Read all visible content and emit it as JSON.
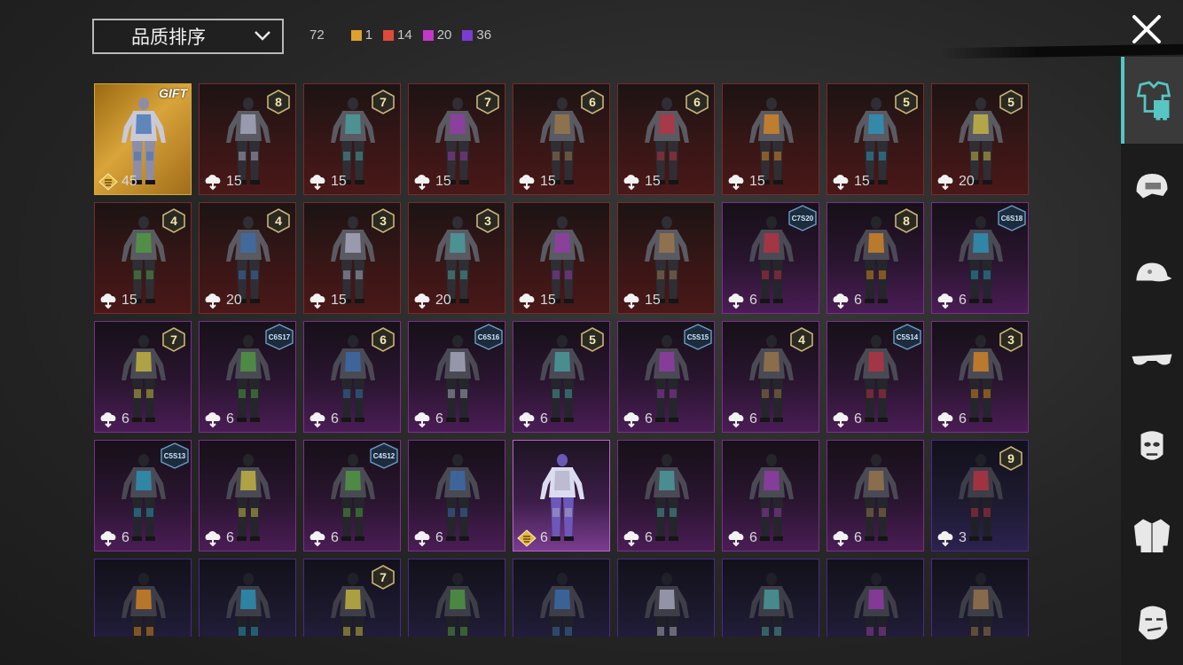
{
  "header": {
    "sort_label": "品质排序",
    "total": "72",
    "counts": [
      {
        "color": "#e0a12c",
        "value": "1"
      },
      {
        "color": "#e04a3a",
        "value": "14"
      },
      {
        "color": "#c338c8",
        "value": "20"
      },
      {
        "color": "#7b3bd4",
        "value": "36"
      }
    ]
  },
  "items": [
    {
      "rarity": "gold",
      "value": "45",
      "gift": "GIFT"
    },
    {
      "rarity": "legendary",
      "value": "15",
      "badge": "8"
    },
    {
      "rarity": "legendary",
      "value": "15",
      "badge": "7"
    },
    {
      "rarity": "legendary",
      "value": "15",
      "badge": "7"
    },
    {
      "rarity": "legendary",
      "value": "15",
      "badge": "6"
    },
    {
      "rarity": "legendary",
      "value": "15",
      "badge": "6"
    },
    {
      "rarity": "legendary",
      "value": "15"
    },
    {
      "rarity": "legendary",
      "value": "15",
      "badge": "5"
    },
    {
      "rarity": "legendary",
      "value": "20",
      "badge": "5"
    },
    {
      "rarity": "legendary",
      "value": "15",
      "badge": "4"
    },
    {
      "rarity": "legendary",
      "value": "20",
      "badge": "4"
    },
    {
      "rarity": "legendary",
      "value": "15",
      "badge": "3"
    },
    {
      "rarity": "legendary",
      "value": "20",
      "badge": "3"
    },
    {
      "rarity": "legendary",
      "value": "15"
    },
    {
      "rarity": "legendary",
      "value": "15"
    },
    {
      "rarity": "epic",
      "value": "6",
      "season": "C7S20"
    },
    {
      "rarity": "epic",
      "value": "6",
      "badge": "8"
    },
    {
      "rarity": "epic",
      "value": "6",
      "season": "C6S18"
    },
    {
      "rarity": "epic",
      "value": "6",
      "badge": "7"
    },
    {
      "rarity": "epic",
      "value": "6",
      "season": "C6S17"
    },
    {
      "rarity": "epic",
      "value": "6",
      "badge": "6"
    },
    {
      "rarity": "epic",
      "value": "6",
      "season": "C6S16"
    },
    {
      "rarity": "epic",
      "value": "6",
      "badge": "5"
    },
    {
      "rarity": "epic",
      "value": "6",
      "season": "C5S15"
    },
    {
      "rarity": "epic",
      "value": "6",
      "badge": "4"
    },
    {
      "rarity": "epic",
      "value": "6",
      "season": "C5S14"
    },
    {
      "rarity": "epic",
      "value": "6",
      "badge": "3"
    },
    {
      "rarity": "epic",
      "value": "6",
      "season": "C5S13"
    },
    {
      "rarity": "epic",
      "value": "6"
    },
    {
      "rarity": "epic",
      "value": "6",
      "season": "C4S12"
    },
    {
      "rarity": "epic",
      "value": "6"
    },
    {
      "rarity": "selected",
      "value": "6",
      "special": true
    },
    {
      "rarity": "epic",
      "value": "6"
    },
    {
      "rarity": "epic",
      "value": "6"
    },
    {
      "rarity": "epic",
      "value": "6"
    },
    {
      "rarity": "elite",
      "value": "3",
      "badge": "9"
    },
    {
      "rarity": "elite",
      "value": ""
    },
    {
      "rarity": "elite",
      "value": ""
    },
    {
      "rarity": "elite",
      "value": "",
      "badge": "7"
    },
    {
      "rarity": "elite",
      "value": ""
    },
    {
      "rarity": "elite",
      "value": ""
    },
    {
      "rarity": "elite",
      "value": ""
    },
    {
      "rarity": "elite",
      "value": ""
    },
    {
      "rarity": "elite",
      "value": ""
    },
    {
      "rarity": "elite",
      "value": ""
    }
  ],
  "sidebar": [
    {
      "icon": "outfit-icon",
      "active": true
    },
    {
      "icon": "helmet-icon"
    },
    {
      "icon": "cap-icon"
    },
    {
      "icon": "glasses-icon"
    },
    {
      "icon": "mask-icon"
    },
    {
      "icon": "jacket-icon"
    },
    {
      "icon": "face-icon"
    }
  ]
}
